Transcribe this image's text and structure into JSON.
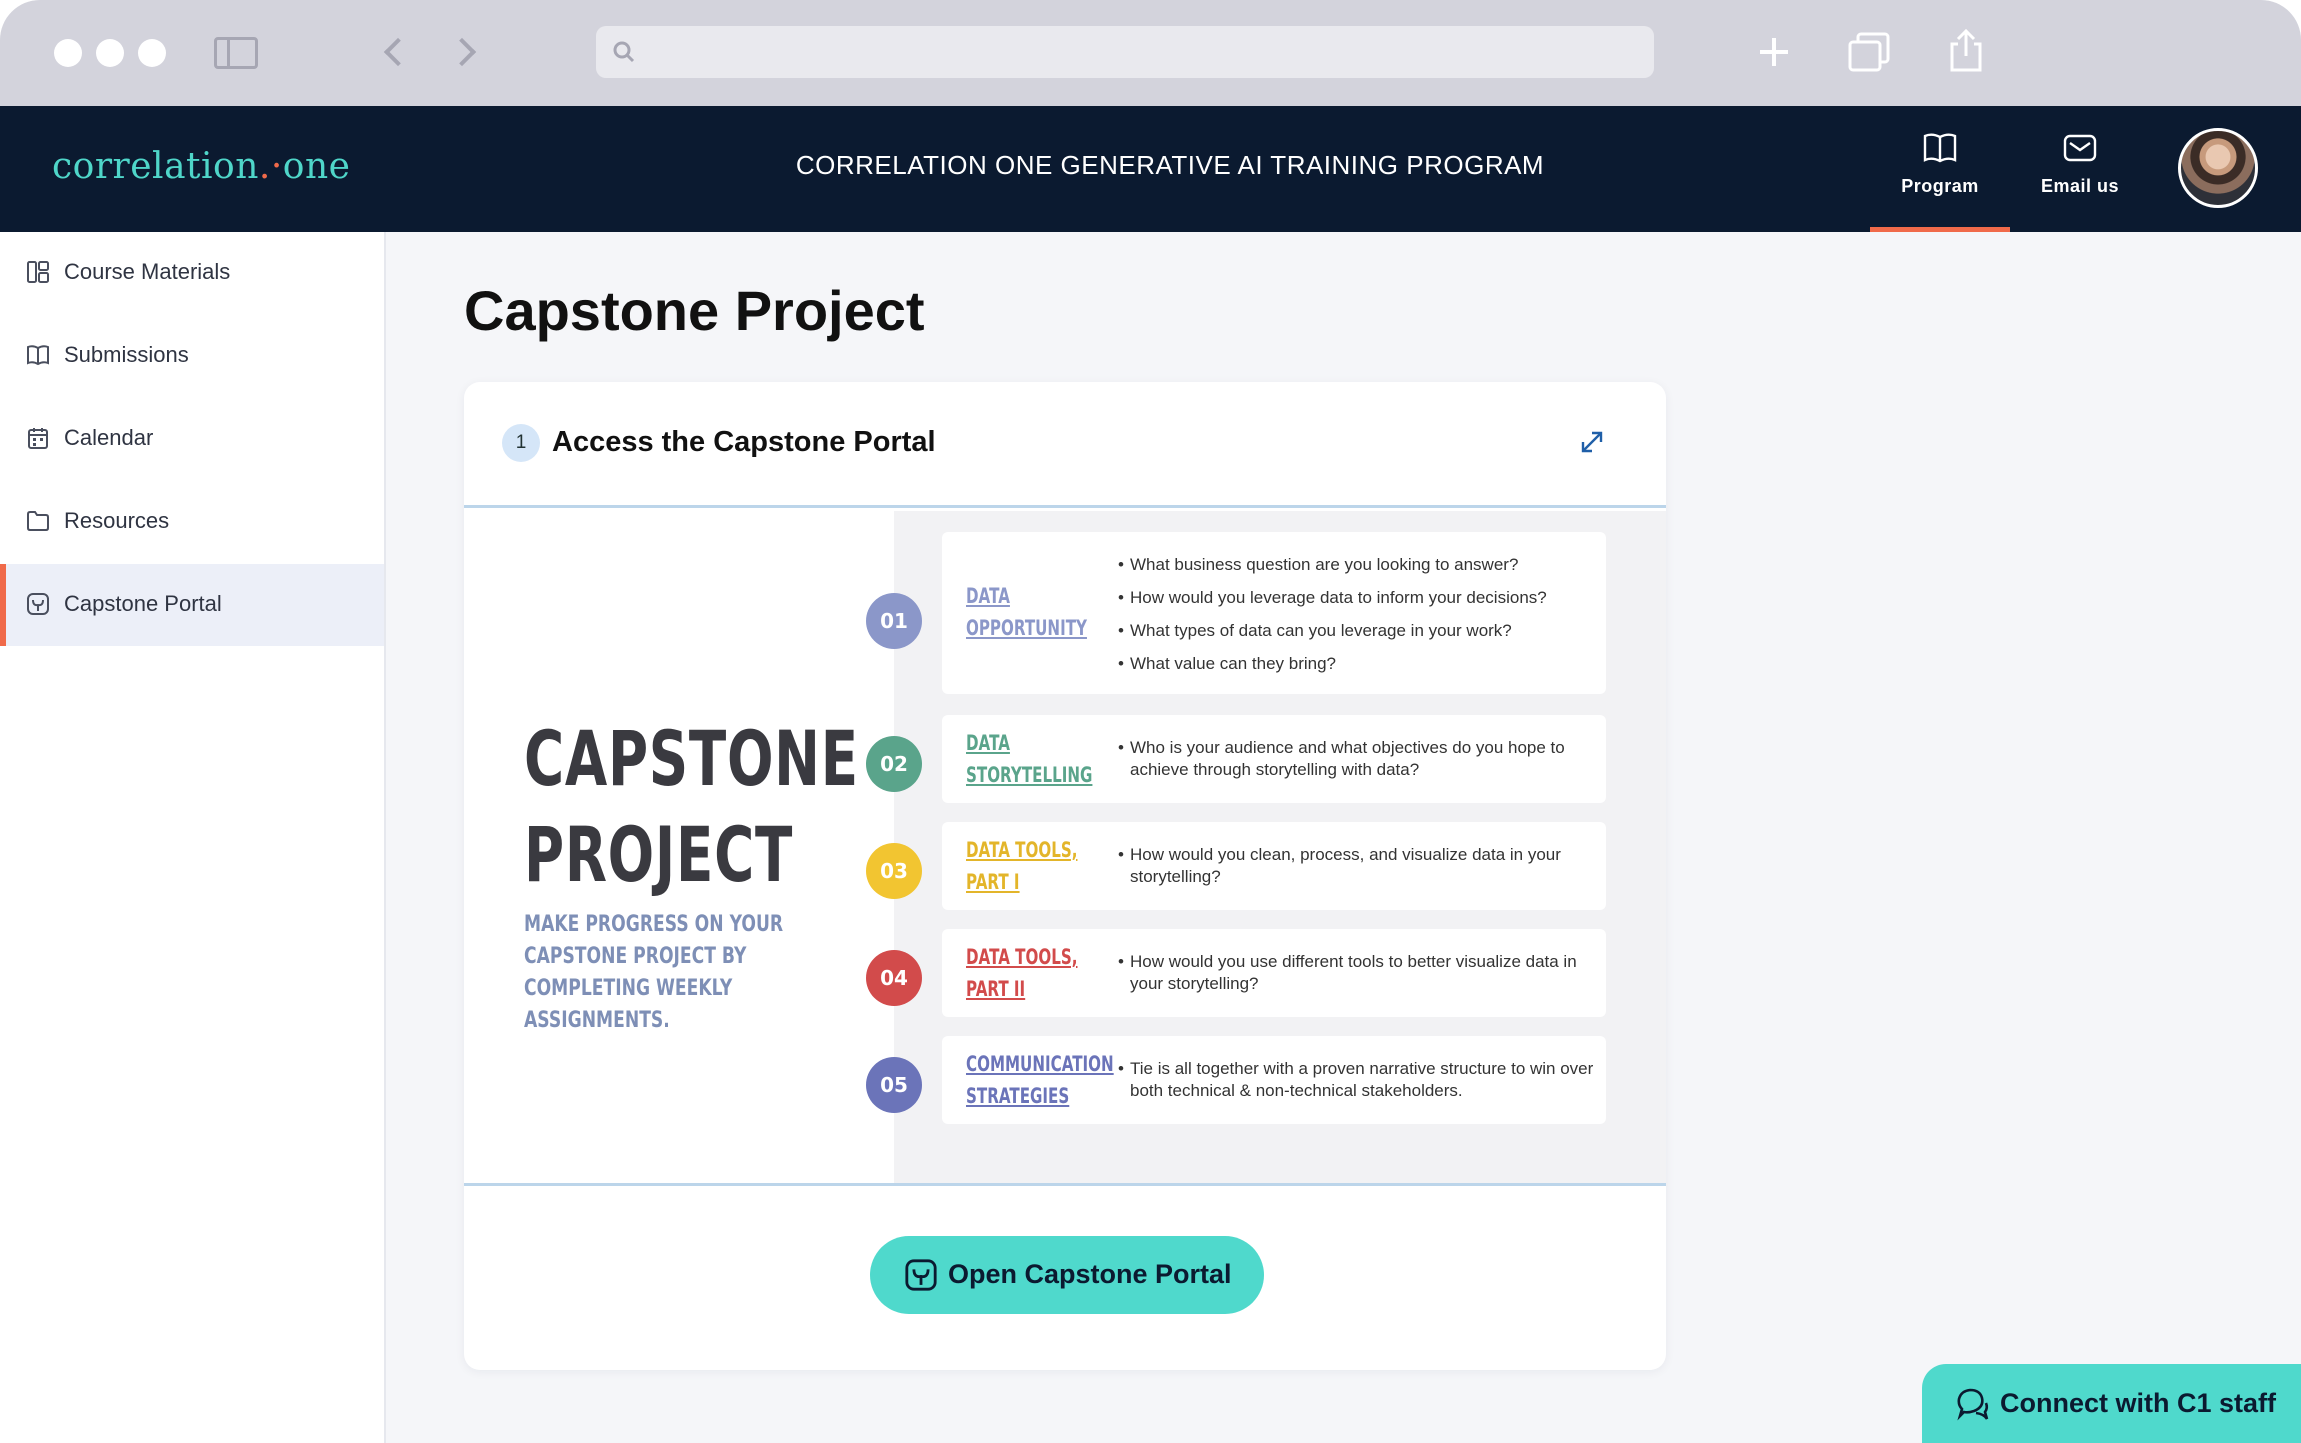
{
  "browser": {
    "address_value": ""
  },
  "header": {
    "logo_text_a": "correlation",
    "logo_text_dots": ".·",
    "logo_text_b": "one",
    "program_title": "CORRELATION ONE GENERATIVE AI TRAINING PROGRAM",
    "nav": [
      {
        "label": "Program",
        "icon": "book-icon",
        "active": true
      },
      {
        "label": "Email us",
        "icon": "mail-icon",
        "active": false
      }
    ]
  },
  "sidebar": {
    "items": [
      {
        "label": "Course Materials",
        "icon": "layout-icon",
        "active": false
      },
      {
        "label": "Submissions",
        "icon": "book-open-icon",
        "active": false
      },
      {
        "label": "Calendar",
        "icon": "calendar-icon",
        "active": false
      },
      {
        "label": "Resources",
        "icon": "folder-icon",
        "active": false
      },
      {
        "label": "Capstone Portal",
        "icon": "portal-icon",
        "active": true
      }
    ]
  },
  "main": {
    "page_title": "Capstone Project",
    "card": {
      "step_number": "1",
      "title": "Access the Capstone Portal",
      "infographic": {
        "title_line1": "CAPSTONE",
        "title_line2": "PROJECT",
        "subtitle": "MAKE PROGRESS ON YOUR CAPSTONE PROJECT BY COMPLETING WEEKLY ASSIGNMENTS.",
        "rows": [
          {
            "number": "01",
            "label_line1": "DATA",
            "label_line2": "OPPORTUNITY",
            "color": "#8b97c9",
            "bullets": [
              "What business question are you looking to answer?",
              "How would you leverage data to inform your decisions?",
              "What types of data can you leverage in your work?",
              "What value can they bring?"
            ]
          },
          {
            "number": "02",
            "label_line1": "DATA",
            "label_line2": "STORYTELLING",
            "color": "#5aa48b",
            "bullets": [
              "Who is your audience and what objectives do you hope to achieve through storytelling with data?"
            ]
          },
          {
            "number": "03",
            "label_line1": "DATA TOOLS,",
            "label_line2": "PART I",
            "color": "#f2c531",
            "bullets": [
              "How would you clean, process, and visualize data in your storytelling?"
            ]
          },
          {
            "number": "04",
            "label_line1": "DATA TOOLS,",
            "label_line2": "PART II",
            "color": "#d24b4b",
            "bullets": [
              "How would you use different tools to better visualize data in your storytelling?"
            ]
          },
          {
            "number": "05",
            "label_line1": "COMMUNICATION",
            "label_line2": "STRATEGIES",
            "color": "#6b74b9",
            "bullets": [
              "Tie is all together with a proven narrative structure to win over both technical & non-technical stakeholders."
            ]
          }
        ]
      },
      "open_button_label": "Open Capstone Portal"
    }
  },
  "connect_button_label": "Connect with C1 staff",
  "colors": {
    "accent_teal": "#4fd9cc",
    "nav_dark": "#0b1a30",
    "active_orange": "#f06a4a"
  }
}
